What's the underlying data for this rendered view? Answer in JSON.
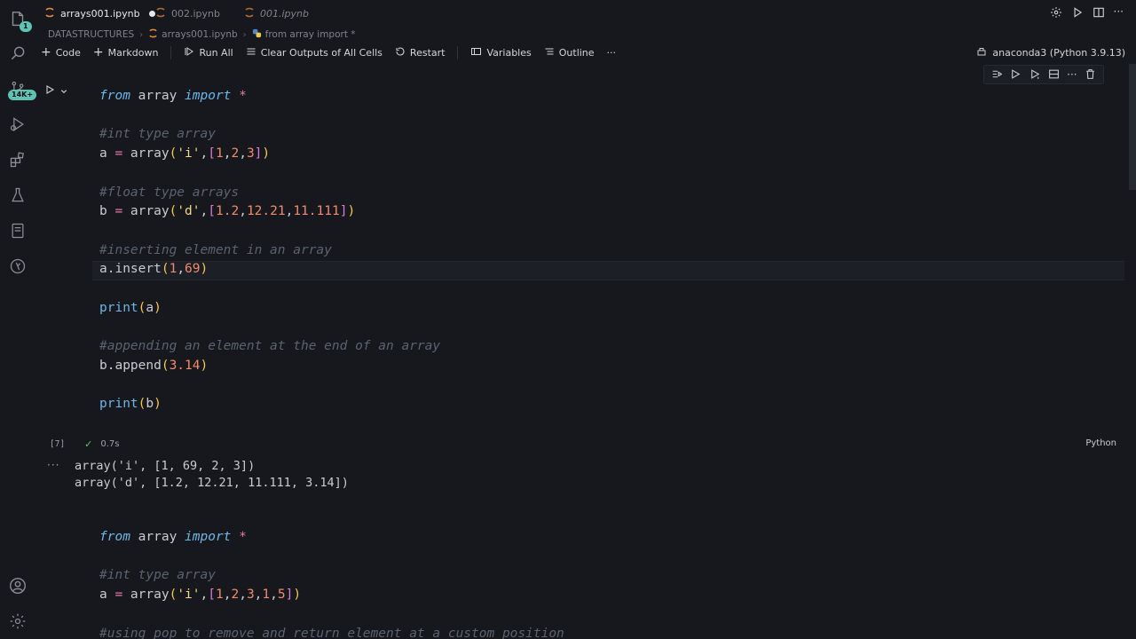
{
  "tabs": [
    {
      "label": "arrays001.ipynb",
      "active": true,
      "dirty": true
    },
    {
      "label": "002.ipynb",
      "active": false
    },
    {
      "label": "001.ipynb",
      "active": false
    }
  ],
  "activity": {
    "explorer_badge": "1",
    "git_badge": "14K+"
  },
  "breadcrumb": [
    "DATASTRUCTURES",
    "arrays001.ipynb",
    "from array import *"
  ],
  "toolbar": {
    "code": "Code",
    "markdown": "Markdown",
    "run_all": "Run All",
    "clear_outputs": "Clear Outputs of All Cells",
    "restart": "Restart",
    "variables": "Variables",
    "outline": "Outline",
    "more": "···"
  },
  "kernel": "anaconda3 (Python 3.9.13)",
  "cell1": {
    "lines": [
      {
        "tokens": [
          [
            "kw",
            "from"
          ],
          [
            "id",
            " array "
          ],
          [
            "kw",
            "import"
          ],
          [
            "op",
            " *"
          ]
        ]
      },
      {
        "tokens": []
      },
      {
        "tokens": [
          [
            "cm",
            "#int type array"
          ]
        ]
      },
      {
        "tokens": [
          [
            "id",
            "a "
          ],
          [
            "op",
            "="
          ],
          [
            "id",
            " array"
          ],
          [
            "b1",
            "("
          ],
          [
            "str",
            "'i'"
          ],
          [
            "pr",
            ","
          ],
          [
            "b2",
            "["
          ],
          [
            "num",
            "1"
          ],
          [
            "pr",
            ","
          ],
          [
            "num",
            "2"
          ],
          [
            "pr",
            ","
          ],
          [
            "num",
            "3"
          ],
          [
            "b2",
            "]"
          ],
          [
            "b1",
            ")"
          ]
        ]
      },
      {
        "tokens": []
      },
      {
        "tokens": [
          [
            "cm",
            "#float type arrays"
          ]
        ]
      },
      {
        "tokens": [
          [
            "id",
            "b "
          ],
          [
            "op",
            "="
          ],
          [
            "id",
            " array"
          ],
          [
            "b1",
            "("
          ],
          [
            "str",
            "'d'"
          ],
          [
            "pr",
            ","
          ],
          [
            "b2",
            "["
          ],
          [
            "num",
            "1.2"
          ],
          [
            "pr",
            ","
          ],
          [
            "num",
            "12.21"
          ],
          [
            "pr",
            ","
          ],
          [
            "num",
            "11.111"
          ],
          [
            "b2",
            "]"
          ],
          [
            "b1",
            ")"
          ]
        ]
      },
      {
        "tokens": []
      },
      {
        "tokens": [
          [
            "cm",
            "#inserting element in an array"
          ]
        ]
      },
      {
        "tokens": [
          [
            "id",
            "a.insert"
          ],
          [
            "b1",
            "("
          ],
          [
            "num",
            "1"
          ],
          [
            "pr",
            ","
          ],
          [
            "num",
            "69"
          ],
          [
            "b1",
            ")"
          ]
        ]
      },
      {
        "tokens": []
      },
      {
        "tokens": [
          [
            "fn",
            "print"
          ],
          [
            "b1",
            "("
          ],
          [
            "id",
            "a"
          ],
          [
            "b1",
            ")"
          ]
        ]
      },
      {
        "tokens": []
      },
      {
        "tokens": [
          [
            "cm",
            "#appending an element at the end of an array"
          ]
        ]
      },
      {
        "tokens": [
          [
            "id",
            "b.append"
          ],
          [
            "b1",
            "("
          ],
          [
            "num",
            "3.14"
          ],
          [
            "b1",
            ")"
          ]
        ]
      },
      {
        "tokens": []
      },
      {
        "tokens": [
          [
            "fn",
            "print"
          ],
          [
            "b1",
            "("
          ],
          [
            "id",
            "b"
          ],
          [
            "b1",
            ")"
          ]
        ]
      }
    ],
    "exec_count": "[7]",
    "exec_time": "0.7s",
    "language": "Python",
    "output": [
      "array('i', [1, 69, 2, 3])",
      "array('d', [1.2, 12.21, 11.111, 3.14])"
    ]
  },
  "cell2": {
    "lines": [
      {
        "tokens": [
          [
            "kw",
            "from"
          ],
          [
            "id",
            " array "
          ],
          [
            "kw",
            "import"
          ],
          [
            "op",
            " *"
          ]
        ]
      },
      {
        "tokens": []
      },
      {
        "tokens": [
          [
            "cm",
            "#int type array"
          ]
        ]
      },
      {
        "tokens": [
          [
            "id",
            "a "
          ],
          [
            "op",
            "="
          ],
          [
            "id",
            " array"
          ],
          [
            "b1",
            "("
          ],
          [
            "str",
            "'i'"
          ],
          [
            "pr",
            ","
          ],
          [
            "b2",
            "["
          ],
          [
            "num",
            "1"
          ],
          [
            "pr",
            ","
          ],
          [
            "num",
            "2"
          ],
          [
            "pr",
            ","
          ],
          [
            "num",
            "3"
          ],
          [
            "pr",
            ","
          ],
          [
            "num",
            "1"
          ],
          [
            "pr",
            ","
          ],
          [
            "num",
            "5"
          ],
          [
            "b2",
            "]"
          ],
          [
            "b1",
            ")"
          ]
        ]
      },
      {
        "tokens": []
      },
      {
        "tokens": [
          [
            "cm",
            "#using pop to remove and return element at a custom position"
          ]
        ]
      }
    ]
  }
}
